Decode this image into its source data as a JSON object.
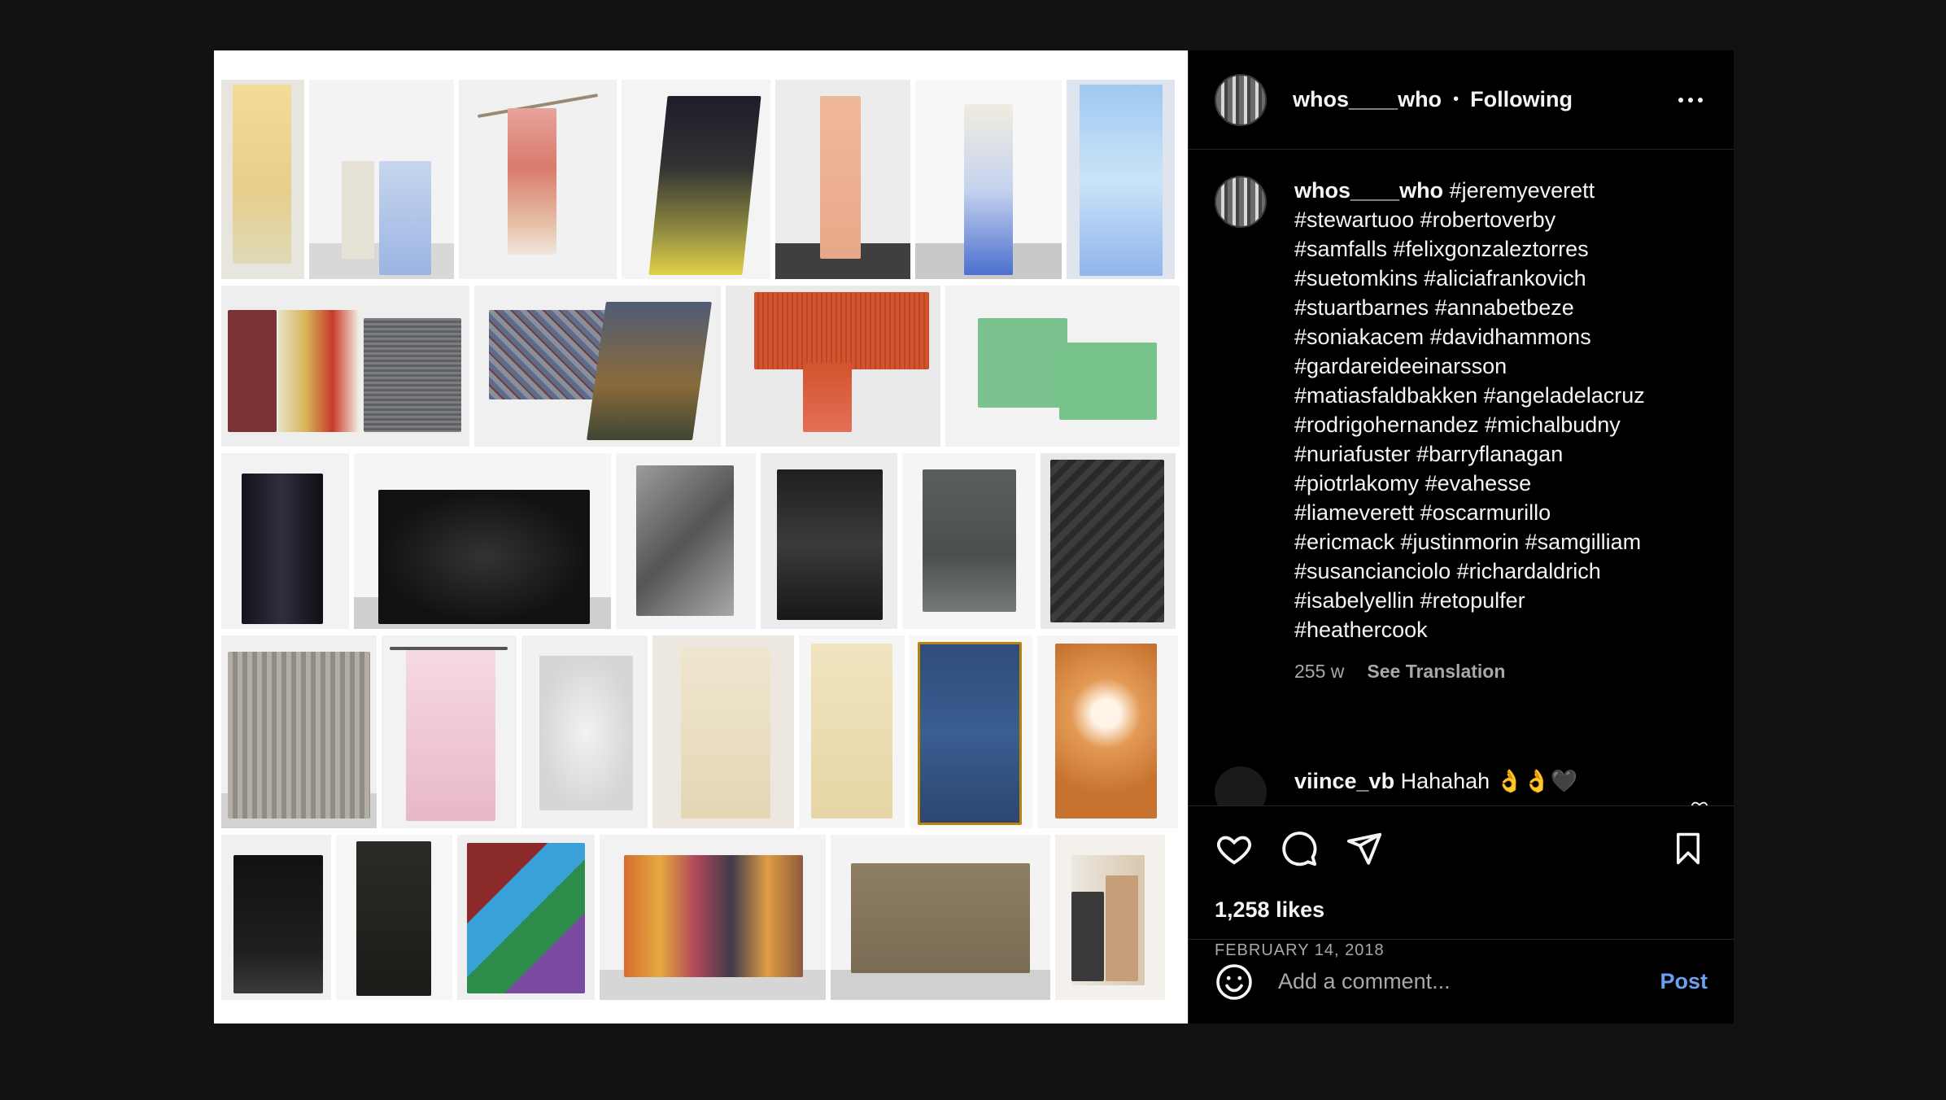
{
  "post": {
    "username": "whos____who",
    "separator": "•",
    "follow_status": "Following",
    "caption_username": "whos____who",
    "caption_hashtags": " #jeremyeverett\n#stewartuoo #robertoverby\n#samfalls #felixgonzaleztorres\n#suetomkins #aliciafrankovich\n#stuartbarnes #annabetbeze\n#soniakacem #davidhammons\n#gardareideeinarsson\n#matiasfaldbakken #angeladelacruz\n#rodrigohernandez #michalbudny\n#nuriafuster #barryflanagan\n#piotrlakomy #evahesse\n#liameverett #oscarmurillo\n#ericmack #justinmorin #samgilliam\n#susancianciolo #richardaldrich\n#isabelyellin #retopulfer\n#heathercook",
    "age": "255 w",
    "see_translation": "See Translation",
    "likes": "1,258 likes",
    "date": "FEBRUARY 14, 2018"
  },
  "comment": {
    "username": "viince_vb",
    "text": " Hahahah 👌👌🖤"
  },
  "composer": {
    "placeholder": "Add a comment...",
    "post_label": "Post"
  },
  "icons": {
    "more": "more-options-icon",
    "like": "heart-icon",
    "comment": "comment-icon",
    "share": "share-icon",
    "save": "bookmark-icon",
    "emoji": "emoji-icon",
    "comment_like": "heart-small-icon"
  },
  "colors": {
    "background": "#121212",
    "panel": "#000000",
    "text": "#f5f5f5",
    "muted": "#a8a8a8",
    "link": "#6c9ff0",
    "divider": "#262626"
  }
}
